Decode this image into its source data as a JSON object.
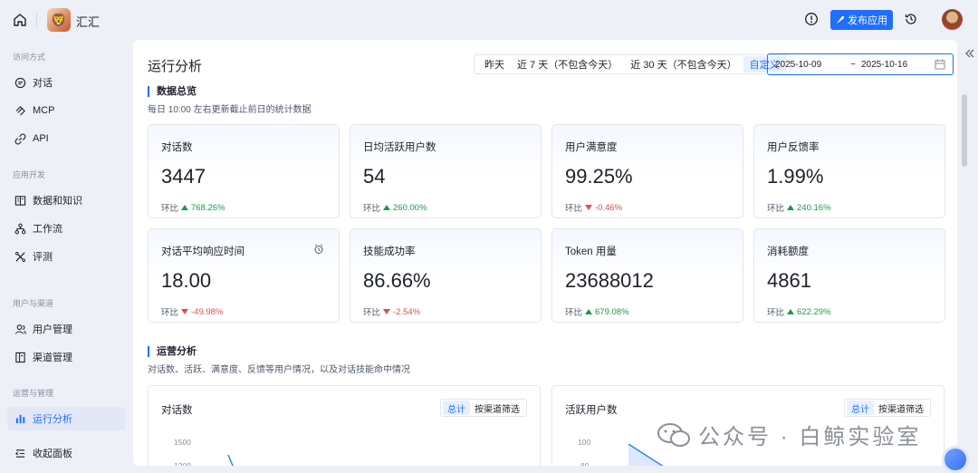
{
  "app": {
    "name": "汇汇",
    "publish_label": "发布应用"
  },
  "sidebar": {
    "groups": [
      {
        "title": "访问方式",
        "items": [
          "对话",
          "MCP",
          "API"
        ]
      },
      {
        "title": "应用开发",
        "items": [
          "数据和知识",
          "工作流",
          "评测"
        ]
      },
      {
        "title": "用户与渠道",
        "items": [
          "用户管理",
          "渠道管理"
        ]
      },
      {
        "title": "运营与管理",
        "items": [
          "运行分析"
        ]
      }
    ],
    "collapse_label": "收起面板",
    "active_item": "运行分析"
  },
  "page": {
    "title": "运行分析",
    "range_tabs": [
      "昨天",
      "近 7 天（不包含今天）",
      "近 30 天（不包含今天）",
      "自定义"
    ],
    "active_range": "自定义",
    "date_start": "2025-10-09",
    "date_sep": "~",
    "date_end": "2025-10-16"
  },
  "overview": {
    "title": "数据总览",
    "subtitle": "每日 10:00 左右更新截止前日的统计数据",
    "trend_prefix": "环比",
    "cards": [
      {
        "label": "对话数",
        "value": "3447",
        "trend": "768.26%",
        "dir": "up"
      },
      {
        "label": "日均活跃用户数",
        "value": "54",
        "trend": "260.00%",
        "dir": "up"
      },
      {
        "label": "用户满意度",
        "value": "99.25%",
        "trend": "-0.46%",
        "dir": "down"
      },
      {
        "label": "用户反馈率",
        "value": "1.99%",
        "trend": "240.16%",
        "dir": "up"
      },
      {
        "label": "对话平均响应时间",
        "value": "18.00",
        "trend": "-49.98%",
        "dir": "down"
      },
      {
        "label": "技能成功率",
        "value": "86.66%",
        "trend": "-2.54%",
        "dir": "down"
      },
      {
        "label": "Token 用量",
        "value": "23688012",
        "trend": "679.08%",
        "dir": "up"
      },
      {
        "label": "消耗额度",
        "value": "4861",
        "trend": "622.29%",
        "dir": "up"
      }
    ]
  },
  "operations": {
    "title": "运营分析",
    "subtitle": "对话数、活跃、满意度、反馈等用户情况，以及对话技能命中情况",
    "charts": [
      {
        "title": "对话数",
        "seg": [
          "总计",
          "按渠道筛选"
        ],
        "yticks": [
          "1500",
          "1200"
        ]
      },
      {
        "title": "活跃用户数",
        "seg": [
          "总计",
          "按渠道筛选"
        ],
        "yticks": [
          "100",
          "80"
        ]
      }
    ]
  },
  "watermark": {
    "text": "公众号 · 白鲸实验室"
  },
  "colors": {
    "accent": "#1f6fff",
    "up": "#1a9c4a",
    "down": "#e34d4d"
  }
}
